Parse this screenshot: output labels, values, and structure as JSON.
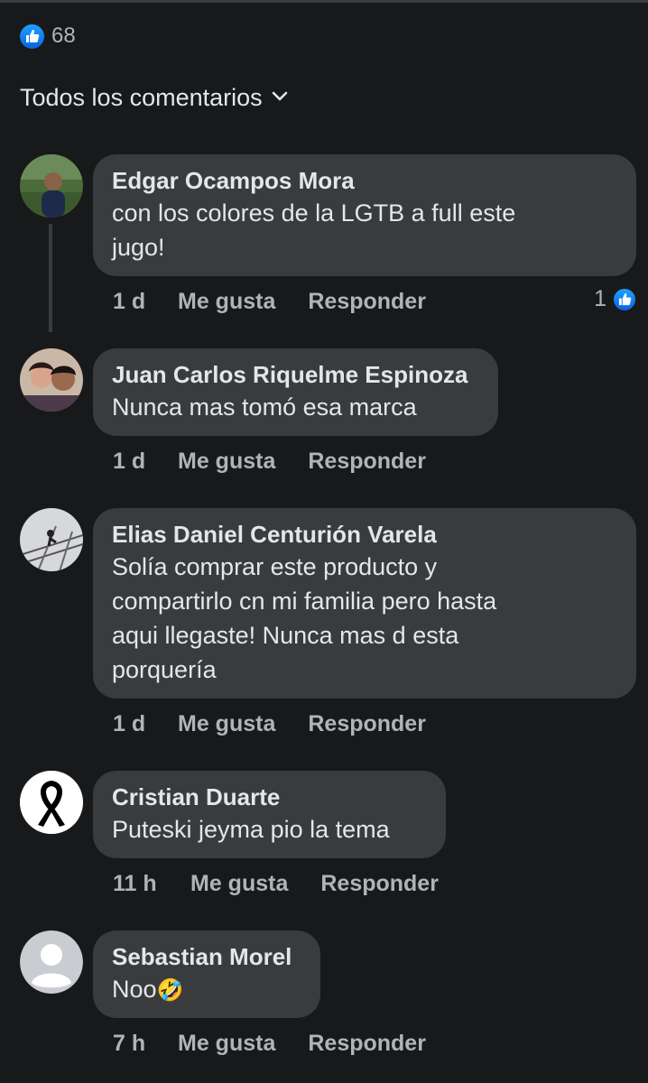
{
  "reactions": {
    "icon": "like-icon",
    "count": "68",
    "color": "#1877f2"
  },
  "sort": {
    "label": "Todos los comentarios",
    "icon": "chevron-down-icon"
  },
  "comments": [
    {
      "author": "Edgar Ocampos Mora",
      "lines": [
        "con los colores de la LGTB a full este",
        "jugo!"
      ],
      "time": "1 d",
      "like": "Me gusta",
      "reply": "Responder",
      "reaction_count": "1"
    },
    {
      "author": "Juan Carlos Riquelme Espinoza",
      "lines": [
        "Nunca mas tomó esa marca"
      ],
      "time": "1 d",
      "like": "Me gusta",
      "reply": "Responder"
    },
    {
      "author": "Elias Daniel Centurión Varela",
      "lines": [
        "Solía comprar este producto y",
        "compartirlo cn mi familia pero hasta",
        "aqui llegaste! Nunca mas d esta",
        "porquería"
      ],
      "time": "1 d",
      "like": "Me gusta",
      "reply": "Responder"
    },
    {
      "author": "Cristian Duarte",
      "lines": [
        "Puteski jeyma pio la tema"
      ],
      "time": "11 h",
      "like": "Me gusta",
      "reply": "Responder"
    },
    {
      "author": "Sebastian Morel",
      "lines": [
        "Noo"
      ],
      "emoji": "🤣",
      "time": "7 h",
      "like": "Me gusta",
      "reply": "Responder"
    }
  ]
}
